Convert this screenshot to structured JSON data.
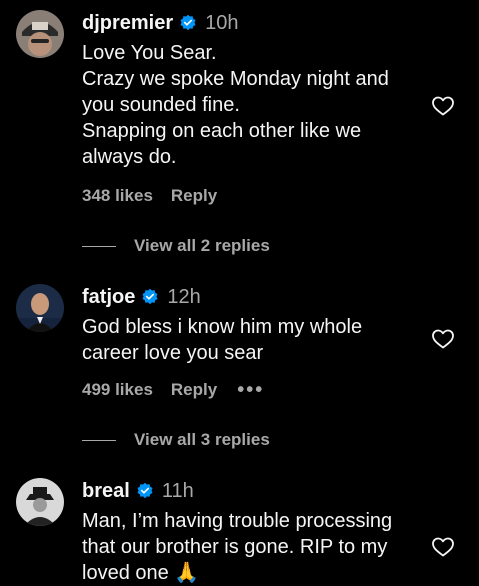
{
  "comments": [
    {
      "username": "djpremier",
      "time": "10h",
      "text": "Love You Sear.\nCrazy we spoke Monday night and you sounded fine.\nSnapping on each other like we always do.",
      "likes": "348 likes",
      "reply_label": "Reply",
      "view_replies": "View all 2 replies"
    },
    {
      "username": "fatjoe",
      "time": "12h",
      "text": "God bless i know him my whole career love you sear",
      "likes": "499 likes",
      "reply_label": "Reply",
      "more_label": "•••",
      "view_replies": "View all 3 replies"
    },
    {
      "username": "breal",
      "time": "11h",
      "text": "Man, I’m having trouble processing that our brother is gone. RIP to my loved one 🙏"
    }
  ],
  "icons": {
    "verified": "verified-badge-icon",
    "heart": "heart-outline-icon",
    "verified_color": "#0095f6"
  }
}
